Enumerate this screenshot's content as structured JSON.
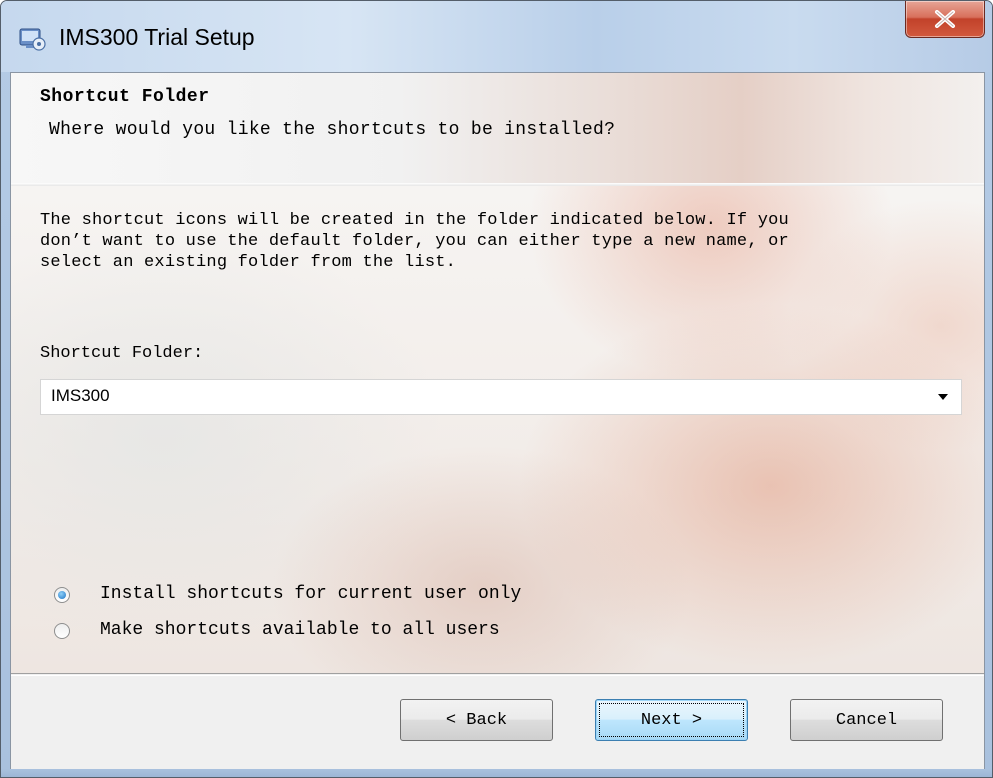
{
  "window": {
    "title": "IMS300 Trial Setup",
    "close_symbol": "X",
    "icon": "installer-icon"
  },
  "header": {
    "title": "Shortcut Folder",
    "subtitle": "Where would you like the shortcuts to be installed?"
  },
  "body": {
    "description": "The shortcut icons will be created in the folder indicated below. If you\ndon’t want to use the default folder, you can either type a new name, or\nselect an existing folder from the list.",
    "folder_label": "Shortcut Folder:",
    "folder_value": "IMS300",
    "radio_options": [
      {
        "label": "Install shortcuts for current user only",
        "selected": true
      },
      {
        "label": "Make shortcuts available to all users",
        "selected": false
      }
    ]
  },
  "footer": {
    "back_label": "< Back",
    "next_label": "Next >",
    "cancel_label": "Cancel"
  },
  "colors": {
    "accent": "#1a72c4",
    "close_button": "#c2422a",
    "default_button_border": "#3c7fb1"
  }
}
